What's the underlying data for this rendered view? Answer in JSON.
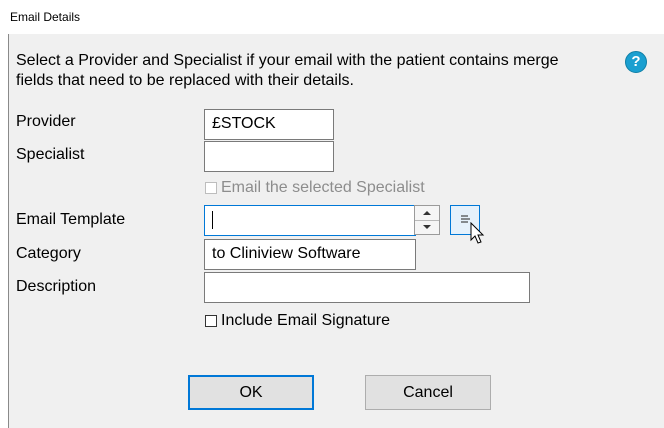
{
  "window": {
    "title": "Email Details"
  },
  "instructions": "Select a Provider and Specialist if your email with the patient contains merge fields that need to be replaced with their details.",
  "help_icon": {
    "icon": "question-mark-icon",
    "glyph": "?"
  },
  "fields": {
    "provider": {
      "label": "Provider",
      "value": "£STOCK"
    },
    "specialist": {
      "label": "Specialist",
      "value": ""
    },
    "email_specialist": {
      "label": "Email the selected Specialist",
      "checked": false,
      "enabled": false
    },
    "email_template": {
      "label": "Email Template",
      "value": ""
    },
    "category": {
      "label": "Category",
      "value": "to Cliniview Software"
    },
    "description": {
      "label": "Description",
      "value": ""
    },
    "include_signature": {
      "label": "Include Email Signature",
      "checked": false
    }
  },
  "buttons": {
    "ok": "OK",
    "cancel": "Cancel"
  },
  "colors": {
    "accent": "#0078d7",
    "help": "#1a9fd0",
    "dialog_bg": "#f0f0f0"
  }
}
